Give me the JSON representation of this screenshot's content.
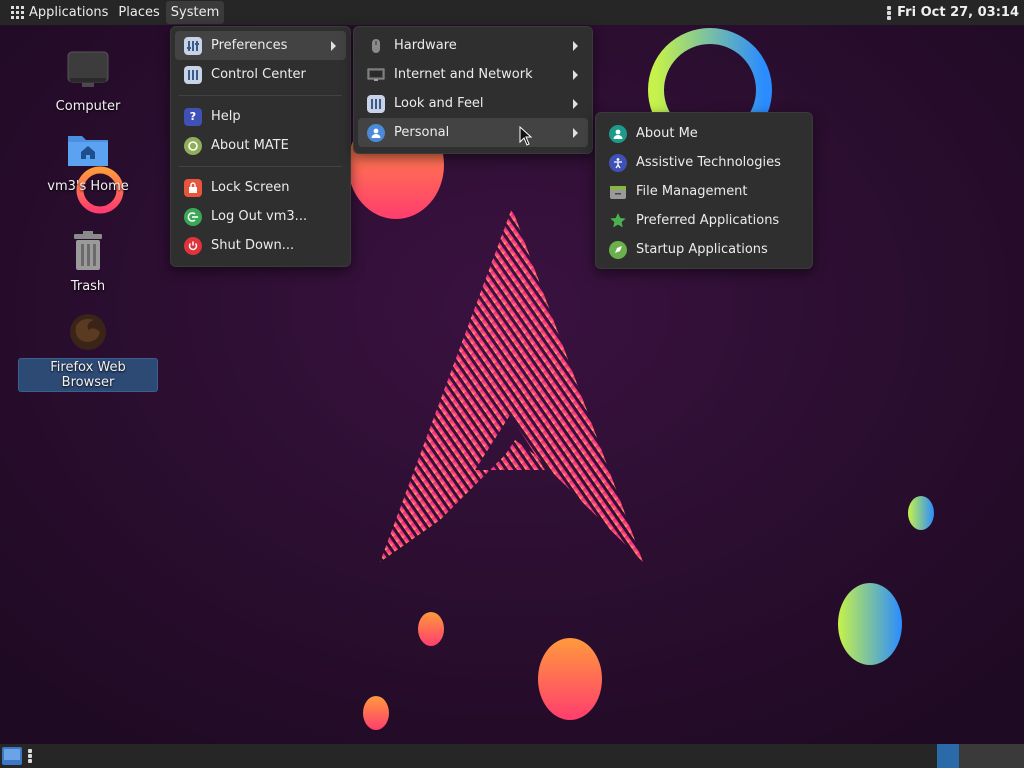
{
  "top_panel": {
    "applications_label": "Applications",
    "places_label": "Places",
    "system_label": "System",
    "clock": "Fri Oct 27, 03:14"
  },
  "desktop": {
    "icons": [
      {
        "label": "Computer",
        "icon": "computer-icon"
      },
      {
        "label": "vm3's Home",
        "icon": "home-folder-icon"
      },
      {
        "label": "Trash",
        "icon": "trash-icon"
      },
      {
        "label": "Firefox Web Browser",
        "icon": "firefox-icon",
        "selected": true
      }
    ]
  },
  "system_menu": {
    "items": [
      {
        "label": "Preferences",
        "icon": "preferences-icon",
        "submenu": true
      },
      {
        "label": "Control Center",
        "icon": "control-center-icon"
      },
      {
        "label": "Help",
        "icon": "help-icon"
      },
      {
        "label": "About MATE",
        "icon": "mate-icon"
      },
      {
        "label": "Lock Screen",
        "icon": "lock-icon"
      },
      {
        "label": "Log Out vm3...",
        "icon": "logout-icon"
      },
      {
        "label": "Shut Down...",
        "icon": "power-icon"
      }
    ]
  },
  "preferences_menu": {
    "items": [
      {
        "label": "Hardware",
        "icon": "mouse-icon"
      },
      {
        "label": "Internet and Network",
        "icon": "network-icon"
      },
      {
        "label": "Look and Feel",
        "icon": "appearance-icon"
      },
      {
        "label": "Personal",
        "icon": "person-icon"
      }
    ]
  },
  "personal_menu": {
    "items": [
      {
        "label": "About Me",
        "icon": "user-icon"
      },
      {
        "label": "Assistive Technologies",
        "icon": "accessibility-icon"
      },
      {
        "label": "File Management",
        "icon": "file-manager-icon"
      },
      {
        "label": "Preferred Applications",
        "icon": "preferred-apps-icon"
      },
      {
        "label": "Startup Applications",
        "icon": "startup-icon"
      }
    ]
  },
  "colors": {
    "panel": "#262626",
    "menu_bg": "#2f2f2f",
    "highlight": "#434343",
    "desktop_bg": "#260d2c",
    "selection": "#2d4a75"
  }
}
